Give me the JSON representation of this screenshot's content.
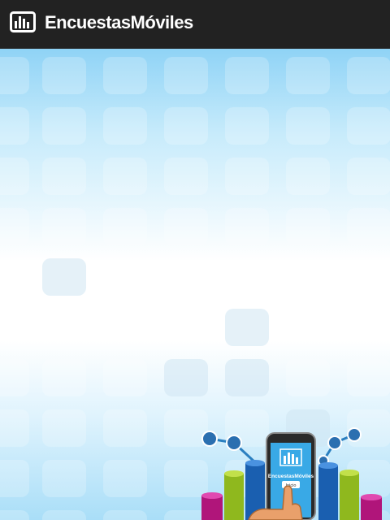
{
  "app": {
    "title": "EncuestasMóviles",
    "icon": "bar-chart-icon",
    "colors": {
      "appbar": "#222222",
      "title": "#ffffff",
      "accent": "#39a9e6"
    }
  },
  "background": {
    "colors": {
      "top": "#8fd3f6",
      "middle": "#ffffff",
      "bottom": "#a9def8"
    }
  },
  "illustration": {
    "phone_title": "EncuestasMóviles",
    "phone_button": "Inicio"
  }
}
